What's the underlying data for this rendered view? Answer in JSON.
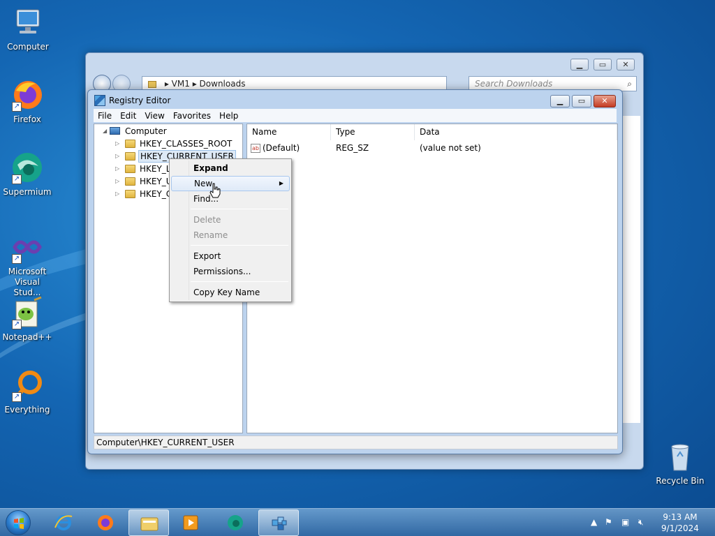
{
  "desktop": {
    "icons": [
      {
        "label": "Computer",
        "icon": "computer-icon"
      },
      {
        "label": "Firefox",
        "icon": "firefox-icon"
      },
      {
        "label": "Supermium",
        "icon": "supermium-icon"
      },
      {
        "label": "Microsoft\nVisual Stud...",
        "icon": "visual-studio-icon"
      },
      {
        "label": "Notepad++",
        "icon": "notepadpp-icon"
      },
      {
        "label": "Everything",
        "icon": "everything-icon"
      },
      {
        "label": "Recycle Bin",
        "icon": "recycle-bin-icon"
      }
    ]
  },
  "explorer": {
    "breadcrumb": [
      "VM1",
      "Downloads"
    ],
    "search_placeholder": "Search Downloads"
  },
  "regedit": {
    "title": "Registry Editor",
    "menu": [
      "File",
      "Edit",
      "View",
      "Favorites",
      "Help"
    ],
    "tree": {
      "root": "Computer",
      "keys": [
        "HKEY_CLASSES_ROOT",
        "HKEY_CURRENT_USER",
        "HKEY_LO",
        "HKEY_US",
        "HKEY_CU"
      ],
      "selected": "HKEY_CURRENT_USER"
    },
    "columns": [
      "Name",
      "Type",
      "Data"
    ],
    "values": [
      {
        "name": "(Default)",
        "type": "REG_SZ",
        "data": "(value not set)"
      }
    ],
    "status": "Computer\\HKEY_CURRENT_USER"
  },
  "context_menu": {
    "items": [
      {
        "label": "Expand",
        "bold": true,
        "enabled": true
      },
      {
        "label": "New",
        "enabled": true,
        "submenu": true,
        "hovered": true
      },
      {
        "label": "Find...",
        "enabled": true
      },
      {
        "label": "Delete",
        "enabled": false
      },
      {
        "label": "Rename",
        "enabled": false
      },
      {
        "label": "Export",
        "enabled": true
      },
      {
        "label": "Permissions...",
        "enabled": true
      },
      {
        "label": "Copy Key Name",
        "enabled": true
      }
    ]
  },
  "taskbar": {
    "apps": [
      "internet-explorer-icon",
      "firefox-icon",
      "explorer-icon",
      "media-player-icon",
      "supermium-icon",
      "regedit-icon"
    ],
    "active_app": "regedit-icon",
    "clock": {
      "time": "9:13 AM",
      "date": "9/1/2024"
    }
  }
}
